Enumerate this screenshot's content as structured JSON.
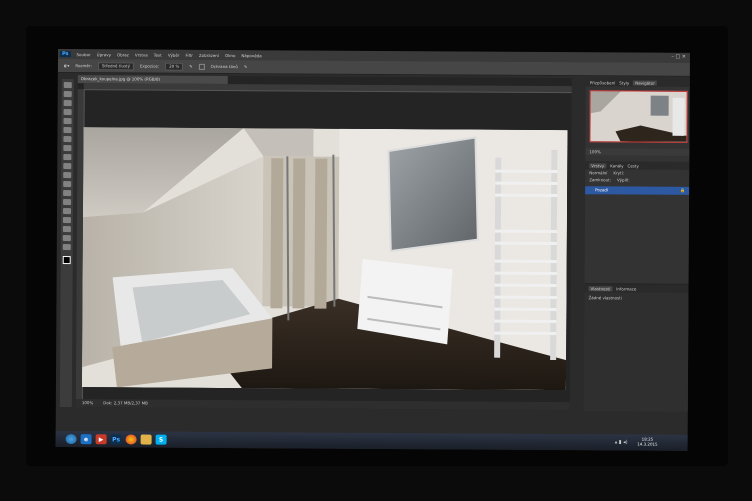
{
  "app": {
    "logo": "Ps",
    "window_controls": "– □ ×"
  },
  "menu": [
    "Soubor",
    "Úpravy",
    "Obraz",
    "Vrstva",
    "Text",
    "Výběr",
    "Filtr",
    "Zobrazení",
    "Okno",
    "Nápověda"
  ],
  "options": {
    "style_label": "Rozměr:",
    "style_value": "Středně tlustý",
    "exposure_label": "Expozice:",
    "exposure_value": "20 %",
    "protect_label": "Ochrana tónů"
  },
  "document": {
    "tab_title": "Obrazek_koupelna.jpg @ 100% (RGB/8)"
  },
  "status": {
    "zoom": "100%",
    "doc_size": "Dok: 2,37 MB/2,37 MB"
  },
  "panels": {
    "top_tabs": [
      "Přizpůsobení",
      "Styly",
      "Navigátor"
    ],
    "zoom": "100%",
    "layer_tabs": [
      "Vrstvy",
      "Kanály",
      "Cesty"
    ],
    "blend_mode": "Normální",
    "opacity": "Krytí:",
    "fill": "Výplň:",
    "lock": "Zamknout:",
    "layer_name": "Pozadí",
    "prop_tabs": [
      "Vlastnosti",
      "Informace"
    ],
    "prop_text": "Žádné vlastnosti"
  },
  "taskbar": {
    "time": "18:25",
    "date": "14.3.2015",
    "ps_label": "Ps"
  },
  "colors": {
    "accent": "#2d59a3",
    "nav_frame": "#cc3333"
  }
}
